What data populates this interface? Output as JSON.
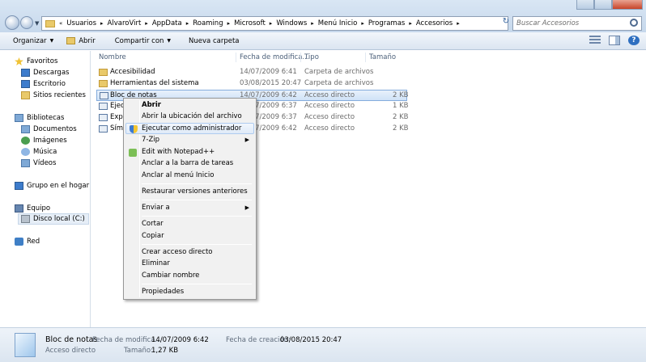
{
  "address": {
    "crumbs": [
      "Usuarios",
      "AlvaroVirt",
      "AppData",
      "Roaming",
      "Microsoft",
      "Windows",
      "Menú Inicio",
      "Programas",
      "Accesorios"
    ],
    "overflow": "«"
  },
  "search": {
    "placeholder": "Buscar Accesorios"
  },
  "toolbar": {
    "organize": "Organizar",
    "open": "Abrir",
    "share": "Compartir con",
    "new_folder": "Nueva carpeta"
  },
  "nav": {
    "favorites": "Favoritos",
    "downloads": "Descargas",
    "desktop": "Escritorio",
    "recent": "Sitios recientes",
    "libraries": "Bibliotecas",
    "documents": "Documentos",
    "images": "Imágenes",
    "music": "Música",
    "videos": "Vídeos",
    "homegroup": "Grupo en el hogar",
    "computer": "Equipo",
    "local_disk": "Disco local (C:)",
    "network": "Red"
  },
  "columns": {
    "name": "Nombre",
    "date": "Fecha de modifica...",
    "type": "Tipo",
    "size": "Tamaño"
  },
  "files": [
    {
      "name": "Accesibilidad",
      "date": "14/07/2009 6:41",
      "type": "Carpeta de archivos",
      "size": ""
    },
    {
      "name": "Herramientas del sistema",
      "date": "03/08/2015 20:47",
      "type": "Carpeta de archivos",
      "size": ""
    },
    {
      "name": "Bloc de notas",
      "date": "14/07/2009 6:42",
      "type": "Acceso directo",
      "size": "2 KB"
    },
    {
      "name": "Ejec",
      "date": "14/07/2009 6:37",
      "type": "Acceso directo",
      "size": "1 KB"
    },
    {
      "name": "Expl",
      "date": "14/07/2009 6:37",
      "type": "Acceso directo",
      "size": "2 KB"
    },
    {
      "name": "Símb",
      "date": "14/07/2009 6:42",
      "type": "Acceso directo",
      "size": "2 KB"
    }
  ],
  "context_menu": {
    "open": "Abrir",
    "open_location": "Abrir la ubicación del archivo",
    "run_as_admin": "Ejecutar como administrador",
    "zip": "7-Zip",
    "notepadpp": "Edit with Notepad++",
    "pin_taskbar": "Anclar a la barra de tareas",
    "pin_start": "Anclar al menú Inicio",
    "restore": "Restaurar versiones anteriores",
    "send_to": "Enviar a",
    "cut": "Cortar",
    "copy": "Copiar",
    "create_shortcut": "Crear acceso directo",
    "delete": "Eliminar",
    "rename": "Cambiar nombre",
    "properties": "Propiedades"
  },
  "details": {
    "name": "Bloc de notas",
    "type": "Acceso directo",
    "modified_label": "Fecha de modifica...",
    "modified": "14/07/2009 6:42",
    "size_label": "Tamaño:",
    "size": "1,27 KB",
    "created_label": "Fecha de creación:",
    "created": "03/08/2015 20:47"
  }
}
